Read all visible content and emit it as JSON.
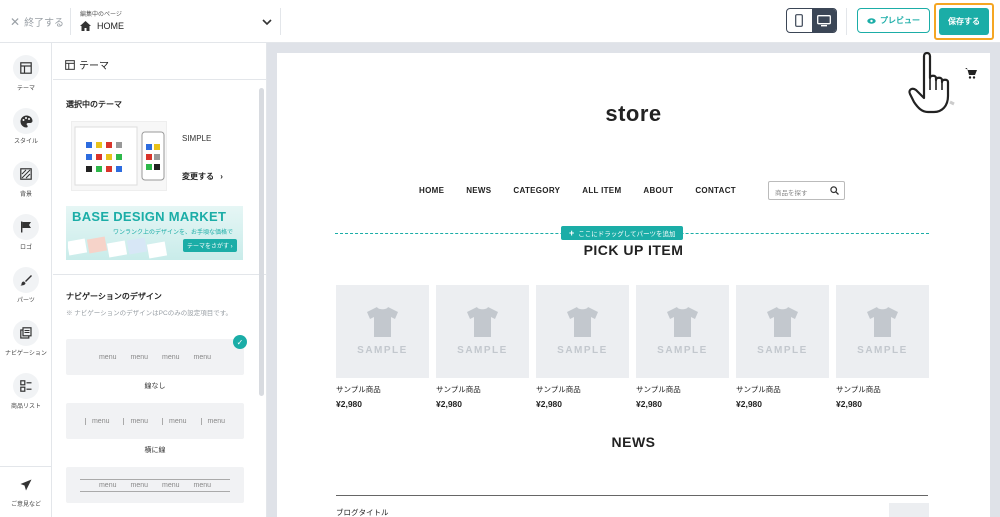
{
  "topbar": {
    "exit_label": "終了する",
    "page_caption": "編集中のページ",
    "page_value": "HOME",
    "preview_label": "プレビュー",
    "save_label": "保存する"
  },
  "rail": {
    "items": [
      {
        "label": "テーマ",
        "icon": "layout-icon"
      },
      {
        "label": "スタイル",
        "icon": "palette-icon"
      },
      {
        "label": "背景",
        "icon": "pattern-icon"
      },
      {
        "label": "ロゴ",
        "icon": "flag-icon"
      },
      {
        "label": "パーツ",
        "icon": "brush-icon"
      },
      {
        "label": "ナビゲーション",
        "icon": "navigation-icon"
      },
      {
        "label": "商品リスト",
        "icon": "list-icon"
      }
    ],
    "feedback_label": "ご意見など"
  },
  "panel": {
    "title": "テーマ",
    "current_theme_heading": "選択中のテーマ",
    "theme_name": "SIMPLE",
    "change_label": "変更する",
    "banner": {
      "title": "BASE DESIGN MARKET",
      "subtitle": "ワンランク上のデザインを、お手頃な価格で",
      "cta": "テーマをさがす"
    },
    "nav_design_heading": "ナビゲーションのデザイン",
    "nav_note": "※ ナビゲーションのデザインはPCのみの設定項目です。",
    "nav_options": [
      {
        "label": "線なし",
        "items": [
          "menu",
          "menu",
          "menu",
          "menu"
        ]
      },
      {
        "label": "横に線",
        "items": [
          "menu",
          "menu",
          "menu",
          "menu"
        ]
      },
      {
        "label": "",
        "items": [
          "menu",
          "menu",
          "menu",
          "menu"
        ]
      }
    ]
  },
  "store": {
    "logo": "store",
    "nav": [
      "HOME",
      "NEWS",
      "CATEGORY",
      "ALL ITEM",
      "ABOUT",
      "CONTACT"
    ],
    "search_placeholder": "商品を探す",
    "drop_label": "ここにドラッグしてパーツを追加",
    "pickup_title": "PICK UP ITEM",
    "products": [
      {
        "image_text": "SAMPLE",
        "name": "サンプル商品",
        "price": "¥2,980"
      },
      {
        "image_text": "SAMPLE",
        "name": "サンプル商品",
        "price": "¥2,980"
      },
      {
        "image_text": "SAMPLE",
        "name": "サンプル商品",
        "price": "¥2,980"
      },
      {
        "image_text": "SAMPLE",
        "name": "サンプル商品",
        "price": "¥2,980"
      },
      {
        "image_text": "SAMPLE",
        "name": "サンプル商品",
        "price": "¥2,980"
      },
      {
        "image_text": "SAMPLE",
        "name": "サンプル商品",
        "price": "¥2,980"
      }
    ],
    "news_title": "NEWS",
    "news_item": "ブログタイトル"
  },
  "colors": {
    "accent": "#1bada7",
    "highlight": "#f5a623",
    "dark": "#3b4656"
  }
}
